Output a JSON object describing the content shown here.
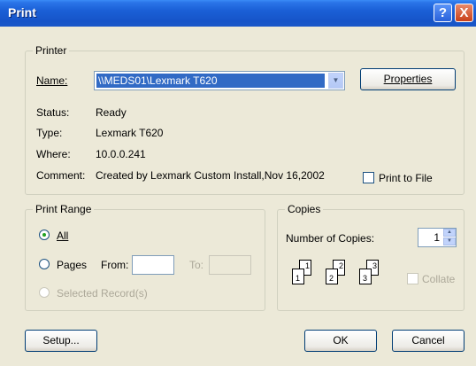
{
  "window": {
    "title": "Print"
  },
  "titlebar": {
    "help_glyph": "?",
    "close_glyph": "X"
  },
  "printer": {
    "legend": "Printer",
    "name_label": "Name:",
    "name_value": "\\\\MEDS01\\Lexmark T620",
    "properties_label": "Properties",
    "status_label": "Status:",
    "status_value": "Ready",
    "type_label": "Type:",
    "type_value": "Lexmark T620",
    "where_label": "Where:",
    "where_value": "10.0.0.241",
    "comment_label": "Comment:",
    "comment_value": "Created by Lexmark Custom Install,Nov 16,2002",
    "print_to_file_label": "Print to File"
  },
  "range": {
    "legend": "Print Range",
    "all_label": "All",
    "pages_label": "Pages",
    "from_label": "From:",
    "to_label": "To:",
    "selected_label": "Selected Record(s)"
  },
  "copies": {
    "legend": "Copies",
    "number_label": "Number of Copies:",
    "number_value": "1",
    "collate_label": "Collate",
    "page_numbers": [
      "1",
      "1",
      "2",
      "2",
      "3",
      "3"
    ]
  },
  "buttons": {
    "setup": "Setup...",
    "ok": "OK",
    "cancel": "Cancel"
  },
  "icons": {
    "dropdown": "chevron-down-icon",
    "help": "help-icon",
    "close": "close-icon"
  }
}
